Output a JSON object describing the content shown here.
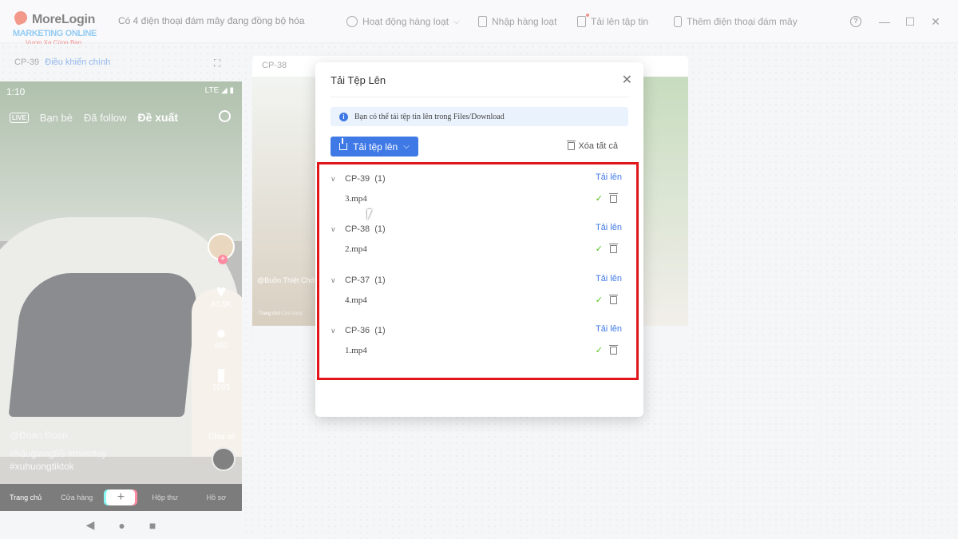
{
  "app": {
    "logo_name": "MoreLogin",
    "logo_watermark_line1": "MARKETING ONLINE",
    "logo_watermark_line2": "Vươn Xa Cùng Bạn",
    "status_text": "Có 4 điện thoại đám mây đang đồng bộ hóa"
  },
  "toolbar": {
    "bulk_actions": "Hoạt động hàng loạt",
    "bulk_import": "Nhập hàng loạt",
    "upload_file": "Tải lên tập tin",
    "add_cloud_phone": "Thêm điện thoại đám mây",
    "help": "?",
    "minimize": "—",
    "maximize": "☐",
    "close": "✕"
  },
  "devices": {
    "main": {
      "id": "CP-39",
      "control_label": "Điều khiển chính",
      "status_time": "1:10",
      "status_right": "LTE ◢ ▮",
      "tabs": [
        "Bạn bè",
        "Đã follow",
        "Đề xuất"
      ],
      "live_badge": "LIVE",
      "likes": "40.5K",
      "comments": "680",
      "saves": "1695",
      "share": "Chia sẻ",
      "author": "@Đoàn Đoan",
      "hashtags_line1": "#hậugiang95 #mientay",
      "hashtags_line2": "#xuhuongtiktok",
      "nav": [
        "Trang chủ",
        "Cửa hàng",
        "+",
        "Hộp thư",
        "Hồ sơ"
      ]
    },
    "second": {
      "id": "CP-38",
      "caption": "@Buồn Thiệt Chớ",
      "nav": [
        "Trang chủ",
        "Cửa hàng"
      ]
    }
  },
  "dialog": {
    "title": "Tải Tệp Lên",
    "close": "✕",
    "info": "Bạn có thể tải tệp tin lên trong Files/Download",
    "upload_button": "Tải tệp lên",
    "clear_all": "Xóa tất cả",
    "groups": [
      {
        "device": "CP-39",
        "count": "(1)",
        "action": "Tải lên",
        "file": "3.mp4"
      },
      {
        "device": "CP-38",
        "count": "(1)",
        "action": "Tải lên",
        "file": "2.mp4"
      },
      {
        "device": "CP-37",
        "count": "(1)",
        "action": "Tải lên",
        "file": "4.mp4"
      },
      {
        "device": "CP-36",
        "count": "(1)",
        "action": "Tải lên",
        "file": "1.mp4"
      }
    ]
  },
  "colors": {
    "accent": "#3f79e6",
    "highlight_border": "#e0161b",
    "success": "#52c41a"
  }
}
